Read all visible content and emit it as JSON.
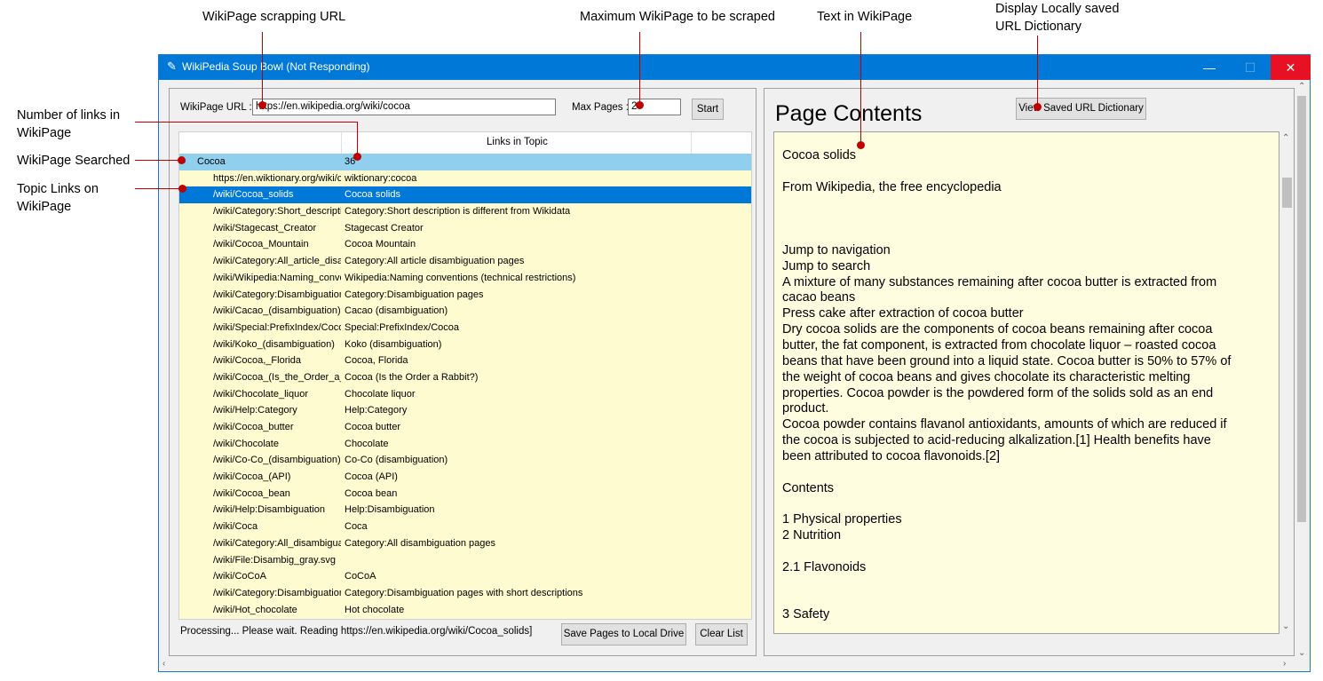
{
  "annotations": {
    "url": "WikiPage scrapping URL",
    "max_pages": "Maximum WikiPage to be scraped",
    "text": "Text in WikiPage",
    "saved_line1": "Display Locally saved",
    "saved_line2": "URL Dictionary",
    "num_links_line1": "Number of links in",
    "num_links_line2": "WikiPage",
    "searched": "WikiPage Searched",
    "topic_line1": "Topic Links on",
    "topic_line2": "WikiPage"
  },
  "window": {
    "title": "WikiPedia Soup Bowl (Not Responding)",
    "minimize": "—",
    "maximize": "☐",
    "close": "✕"
  },
  "controls": {
    "url_label": "WikiPage URL :",
    "url_value": "https://en.wikipedia.org/wiki/cocoa",
    "max_label": "Max Pages :",
    "max_value": "2",
    "start": "Start",
    "view_saved": "View Saved URL Dictionary",
    "save_pages": "Save Pages to Local Drive",
    "clear_list": "Clear List"
  },
  "tree": {
    "column_header": "Links in Topic",
    "parent": {
      "name": "Cocoa",
      "count": "36"
    },
    "rows": [
      {
        "link": "https://en.wiktionary.org/wiki/cocoa",
        "title": "wiktionary:cocoa"
      },
      {
        "link": "/wiki/Cocoa_solids",
        "title": "Cocoa solids",
        "selected": true
      },
      {
        "link": "/wiki/Category:Short_description",
        "title": "Category:Short description is different from Wikidata"
      },
      {
        "link": "/wiki/Stagecast_Creator",
        "title": "Stagecast Creator"
      },
      {
        "link": "/wiki/Cocoa_Mountain",
        "title": "Cocoa Mountain"
      },
      {
        "link": "/wiki/Category:All_article_disambiguation_pages",
        "title": "Category:All article disambiguation pages"
      },
      {
        "link": "/wiki/Wikipedia:Naming_conventions",
        "title": "Wikipedia:Naming conventions (technical restrictions)"
      },
      {
        "link": "/wiki/Category:Disambiguation_pages",
        "title": "Category:Disambiguation pages"
      },
      {
        "link": "/wiki/Cacao_(disambiguation)",
        "title": "Cacao (disambiguation)"
      },
      {
        "link": "/wiki/Special:PrefixIndex/Cocoa",
        "title": "Special:PrefixIndex/Cocoa"
      },
      {
        "link": "/wiki/Koko_(disambiguation)",
        "title": "Koko (disambiguation)"
      },
      {
        "link": "/wiki/Cocoa,_Florida",
        "title": "Cocoa, Florida"
      },
      {
        "link": "/wiki/Cocoa_(Is_the_Order_a_Rabbit?)",
        "title": "Cocoa (Is the Order a Rabbit?)"
      },
      {
        "link": "/wiki/Chocolate_liquor",
        "title": "Chocolate liquor"
      },
      {
        "link": "/wiki/Help:Category",
        "title": "Help:Category"
      },
      {
        "link": "/wiki/Cocoa_butter",
        "title": "Cocoa butter"
      },
      {
        "link": "/wiki/Chocolate",
        "title": "Chocolate"
      },
      {
        "link": "/wiki/Co-Co_(disambiguation)",
        "title": "Co-Co (disambiguation)"
      },
      {
        "link": "/wiki/Cocoa_(API)",
        "title": "Cocoa (API)"
      },
      {
        "link": "/wiki/Cocoa_bean",
        "title": "Cocoa bean"
      },
      {
        "link": "/wiki/Help:Disambiguation",
        "title": "Help:Disambiguation"
      },
      {
        "link": "/wiki/Coca",
        "title": "Coca"
      },
      {
        "link": "/wiki/Category:All_disambiguation_pages",
        "title": "Category:All disambiguation pages"
      },
      {
        "link": "/wiki/File:Disambig_gray.svg",
        "title": ""
      },
      {
        "link": "/wiki/CoCoA",
        "title": "CoCoA"
      },
      {
        "link": "/wiki/Category:Disambiguation_pages_with_short_descriptions",
        "title": "Category:Disambiguation pages with short descriptions"
      },
      {
        "link": "/wiki/Hot_chocolate",
        "title": "Hot chocolate"
      }
    ]
  },
  "status": "Processing... Please wait. Reading https://en.wikipedia.org/wiki/Cocoa_solids]",
  "page_contents": {
    "title": "Page Contents",
    "lines": [
      "",
      "Cocoa solids",
      "",
      "From Wikipedia, the free encyclopedia",
      "",
      "",
      "",
      "Jump to navigation",
      "Jump to search",
      "A mixture of many substances remaining after cocoa butter is extracted from",
      "cacao beans",
      " Press cake after extraction of cocoa butter",
      "Dry cocoa solids are the components of cocoa beans remaining after cocoa",
      "butter, the fat component, is extracted from chocolate liquor – roasted cocoa",
      "beans that have been ground into a liquid state. Cocoa butter is 50% to 57% of",
      "the weight of cocoa beans and gives chocolate its characteristic melting",
      "properties. Cocoa powder is the powdered form of the solids sold as an end",
      "product.",
      "Cocoa powder contains flavanol antioxidants, amounts of which are reduced if",
      "the cocoa is subjected to acid-reducing alkalization.[1] Health benefits have",
      "been attributed to cocoa flavonoids.[2]",
      "",
      "Contents",
      "",
      "1 Physical properties",
      "2 Nutrition",
      "",
      "2.1 Flavonoids",
      "",
      "",
      "3 Safety"
    ]
  },
  "colors": {
    "titlebar": "#0078d7",
    "annotation": "#c00000",
    "tree_bg": "#fffbd0",
    "selected": "#0078d7",
    "parent_row": "#90d0ee"
  }
}
